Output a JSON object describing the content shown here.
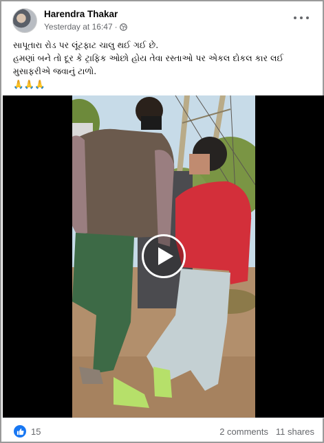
{
  "post": {
    "author": "Harendra Thakar",
    "timestamp": "Yesterday at 16:47",
    "separator": "·",
    "privacy_icon": "globe-icon",
    "caption_lines": [
      "સાપૂતારા રોડ પર લૂંટફાટ ચાલુ થઈ ગઈ છે.",
      "હમણાં બને તો દૂર કે ટ્રાફિક ઓછો હોય તેવા રસ્તાઓ પર એકલ દોકલ કાર લઈ",
      "મુસાફરીએ જવાનું ટાળો.",
      "🙏🙏🙏"
    ]
  },
  "video": {
    "play_icon": "play-icon"
  },
  "reactions": {
    "icon": "like-icon",
    "count": "15",
    "comments": "2 comments",
    "shares": "11 shares"
  },
  "colors": {
    "accent": "#1877f2",
    "secondary_text": "#65676b",
    "border": "#9a9a9a"
  }
}
